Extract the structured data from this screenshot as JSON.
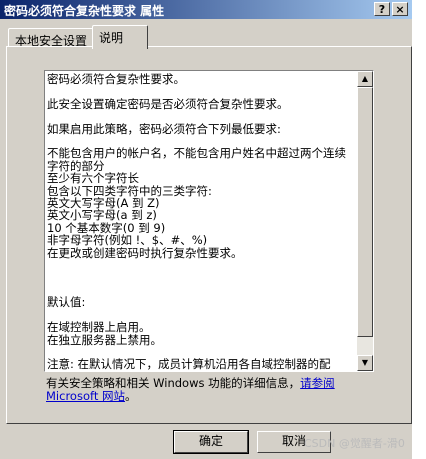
{
  "window": {
    "title": "密码必须符合复杂性要求 属性",
    "help_glyph": "?",
    "close_glyph": "×"
  },
  "tabs": [
    {
      "label": "本地安全设置"
    },
    {
      "label": "说明"
    }
  ],
  "explain_text": "密码必须符合复杂性要求。\n\n此安全设置确定密码是否必须符合复杂性要求。\n\n如果启用此策略，密码必须符合下列最低要求:\n\n不能包含用户的帐户名，不能包含用户姓名中超过两个连续字符的部分\n至少有六个字符长\n包含以下四类字符中的三类字符:\n英文大写字母(A 到 Z)\n英文小写字母(a 到 z)\n10 个基本数字(0 到 9)\n非字母字符(例如 !、$、#、%)\n在更改或创建密码时执行复杂性要求。\n\n\n\n默认值:\n\n在域控制器上启用。\n在独立服务器上禁用。\n\n注意: 在默认情况下，成员计算机沿用各自域控制器的配",
  "footer": {
    "text": "有关安全策略和相关 Windows 功能的详细信息，",
    "link": "请参阅 Microsoft 网站",
    "after": "。"
  },
  "buttons": {
    "ok": "确定",
    "cancel": "取消"
  },
  "watermark": "CSDN @觉醒者-滑0",
  "scrollbar": {
    "up_glyph": "▲",
    "down_glyph": "▼",
    "position": 0
  }
}
